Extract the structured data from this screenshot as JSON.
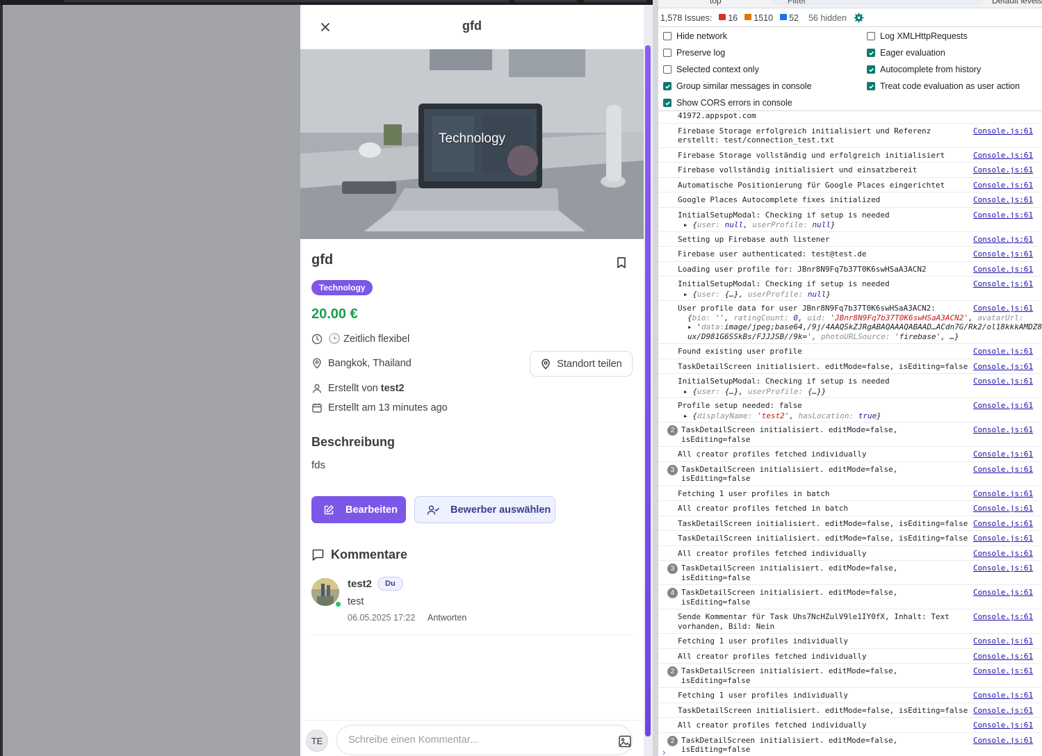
{
  "window": {
    "title": "gfd"
  },
  "hero": {
    "caption": "Technology"
  },
  "task": {
    "title": "gfd",
    "category": "Technology",
    "price": "20.00 €",
    "time": "🕒 Zeitlich flexibel",
    "location": "Bangkok, Thailand",
    "share_label": "Standort teilen",
    "created_by_prefix": "Erstellt von",
    "created_by": "test2",
    "created_at": "Erstellt am 13 minutes ago",
    "description_heading": "Beschreibung",
    "description": "fds",
    "edit_label": "Bearbeiten",
    "applicants_label": "Bewerber auswählen"
  },
  "comments": {
    "heading": "Kommentare",
    "items": [
      {
        "author": "test2",
        "badge": "Du",
        "text": "test",
        "date": "06.05.2025 17:22",
        "reply": "Antworten"
      }
    ],
    "composer_avatar": "TE",
    "placeholder": "Schreibe einen Kommentar..."
  },
  "devtools": {
    "filter_placeholder": "Filter",
    "context": "top",
    "levels": "Default levels",
    "issues": {
      "total": "1,578 Issues:",
      "errors": "16",
      "warnings": "1510",
      "info": "52",
      "hidden": "56 hidden"
    },
    "settings_left": [
      {
        "label": "Hide network",
        "checked": false
      },
      {
        "label": "Preserve log",
        "checked": false
      },
      {
        "label": "Selected context only",
        "checked": false
      },
      {
        "label": "Group similar messages in console",
        "checked": true
      },
      {
        "label": "Show CORS errors in console",
        "checked": true
      }
    ],
    "settings_right": [
      {
        "label": "Log XMLHttpRequests",
        "checked": false
      },
      {
        "label": "Eager evaluation",
        "checked": true
      },
      {
        "label": "Autocomplete from history",
        "checked": true
      },
      {
        "label": "Treat code evaluation as user action",
        "checked": true
      }
    ],
    "source": "Console.js:61",
    "logs": [
      {
        "text": "41972.appspot.com",
        "count": null,
        "src": false
      },
      {
        "text": "Firebase Storage erfolgreich initialisiert und Referenz\nerstellt: test/connection_test.txt",
        "count": null,
        "src": true
      },
      {
        "text": "Firebase Storage vollständig und erfolgreich initialisiert",
        "count": null,
        "src": true
      },
      {
        "text": "Firebase vollständig initialisiert und einsatzbereit",
        "count": null,
        "src": true
      },
      {
        "text": "Automatische Positionierung für Google Places eingerichtet",
        "count": null,
        "src": true
      },
      {
        "text": "Google Places Autocomplete fixes initialized",
        "count": null,
        "src": true
      },
      {
        "text": "InitialSetupModal: Checking if setup is needed",
        "count": null,
        "src": true,
        "obj": "{user: null, userProfile: null}"
      },
      {
        "text": "Setting up Firebase auth listener",
        "count": null,
        "src": true
      },
      {
        "text": "Firebase user authenticated: test@test.de",
        "count": null,
        "src": true
      },
      {
        "text": "Loading user profile for: JBnr8N9Fq7b37T0K6swHSaA3ACN2",
        "count": null,
        "src": true
      },
      {
        "text": "InitialSetupModal: Checking if setup is needed",
        "count": null,
        "src": true,
        "obj": "{user: {…}, userProfile: null}"
      },
      {
        "text": "User profile data for user JBnr8N9Fq7b37T0K6swHSaA3ACN2:",
        "count": null,
        "src": true,
        "obj3": [
          "{bio: '', ratingCount: 0, uid: 'JBnr8N9Fq7b37T0K6swHSaA3ACN2', avatarUrl:",
          "'data:image/jpeg;base64,/9j/4AAQSkZJRgABAQAAAQABAAD…ACdn7G/Rk2/ol18kkkAMDZ8",
          "ux/D981G6SSkBs/FJJJSB//9k=', photoURLSource: 'firebase', …}"
        ]
      },
      {
        "text": "Found existing user profile",
        "count": null,
        "src": true
      },
      {
        "text": "TaskDetailScreen initialisiert. editMode=false, isEditing=false",
        "count": null,
        "src": true
      },
      {
        "text": "InitialSetupModal: Checking if setup is needed",
        "count": null,
        "src": true,
        "obj": "{user: {…}, userProfile: {…}}"
      },
      {
        "text": "Profile setup needed: false",
        "count": null,
        "src": true,
        "obj": "{displayName: 'test2', hasLocation: true}"
      },
      {
        "text": "TaskDetailScreen initialisiert. editMode=false,\nisEditing=false",
        "count": "2",
        "src": true
      },
      {
        "text": "All creator profiles fetched individually",
        "count": null,
        "src": true
      },
      {
        "text": "TaskDetailScreen initialisiert. editMode=false,\nisEditing=false",
        "count": "3",
        "src": true
      },
      {
        "text": "Fetching 1 user profiles in batch",
        "count": null,
        "src": true
      },
      {
        "text": "All creator profiles fetched in batch",
        "count": null,
        "src": true
      },
      {
        "text": "TaskDetailScreen initialisiert. editMode=false, isEditing=false",
        "count": null,
        "src": true
      },
      {
        "text": "TaskDetailScreen initialisiert. editMode=false, isEditing=false",
        "count": null,
        "src": true
      },
      {
        "text": "All creator profiles fetched individually",
        "count": null,
        "src": true
      },
      {
        "text": "TaskDetailScreen initialisiert. editMode=false,\nisEditing=false",
        "count": "3",
        "src": true
      },
      {
        "text": "TaskDetailScreen initialisiert. editMode=false,\nisEditing=false",
        "count": "4",
        "src": true
      },
      {
        "text": "Sende Kommentar für Task Uhs7NcHZulV9le1IY0fX, Inhalt: Text\nvorhanden, Bild: Nein",
        "count": null,
        "src": true
      },
      {
        "text": "Fetching 1 user profiles individually",
        "count": null,
        "src": true
      },
      {
        "text": "All creator profiles fetched individually",
        "count": null,
        "src": true
      },
      {
        "text": "TaskDetailScreen initialisiert. editMode=false,\nisEditing=false",
        "count": "2",
        "src": true
      },
      {
        "text": "Fetching 1 user profiles individually",
        "count": null,
        "src": true
      },
      {
        "text": "TaskDetailScreen initialisiert. editMode=false, isEditing=false",
        "count": null,
        "src": true
      },
      {
        "text": "All creator profiles fetched individually",
        "count": null,
        "src": true
      },
      {
        "text": "TaskDetailScreen initialisiert. editMode=false,\nisEditing=false",
        "count": "2",
        "src": true
      }
    ],
    "prompt": "›"
  },
  "colors": {
    "accent": "#7c57e8",
    "price": "#18a04a",
    "online": "#22c55e",
    "link": "#1a0dab"
  }
}
